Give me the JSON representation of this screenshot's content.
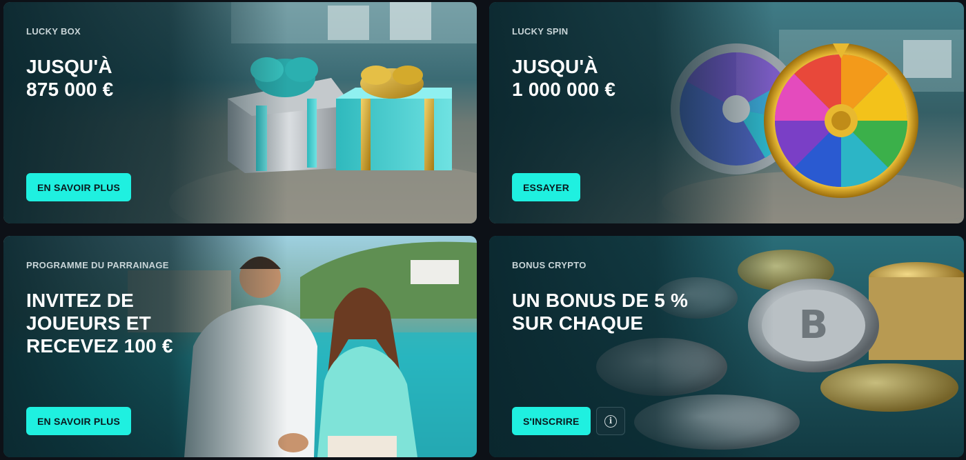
{
  "cards": [
    {
      "tag": "LUCKY BOX",
      "headline": "JUSQU'À\n875 000 €",
      "button": "EN SAVOIR PLUS"
    },
    {
      "tag": "LUCKY SPIN",
      "headline": "JUSQU'À\n1 000 000 €",
      "button": "ESSAYER"
    },
    {
      "tag": "PROGRAMME DU PARRAINAGE",
      "headline": "INVITEZ DE\nJOUEURS ET\nRECEVEZ 100 €",
      "button": "EN SAVOIR PLUS"
    },
    {
      "tag": "BONUS CRYPTO",
      "headline": "UN BONUS DE 5 %\nSUR CHAQUE",
      "button": "S'INSCRIRE",
      "info_icon": "info-icon",
      "info_glyph": "i"
    }
  ],
  "colors": {
    "accent": "#1ff0e0",
    "page_bg": "#0d1117",
    "card_bg": "#0e2a31"
  }
}
